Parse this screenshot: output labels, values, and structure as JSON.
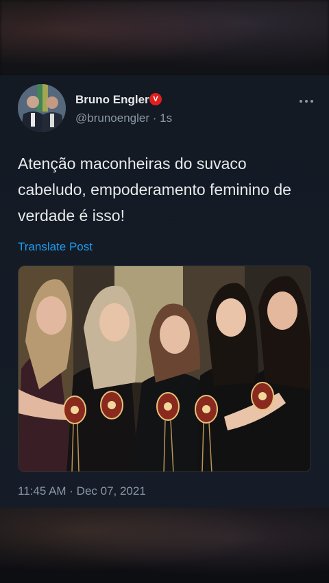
{
  "tweet": {
    "author_name": "Bruno Engler",
    "verified_badge": "V",
    "handle": "@brunoengler",
    "separator": "·",
    "age": "1s",
    "more_icon": "more-horizontal-icon",
    "text": "Atenção maconheiras do suvaco cabeludo, empoderamento feminino de verdade é isso!",
    "translate_label": "Translate Post",
    "timestamp": "11:45 AM · Dec 07, 2021"
  },
  "colors": {
    "text_primary": "#e7e9ea",
    "text_secondary": "#8b98a5",
    "link": "#1d9bf0",
    "badge": "#e0201e",
    "card_bg": "#151c27"
  }
}
